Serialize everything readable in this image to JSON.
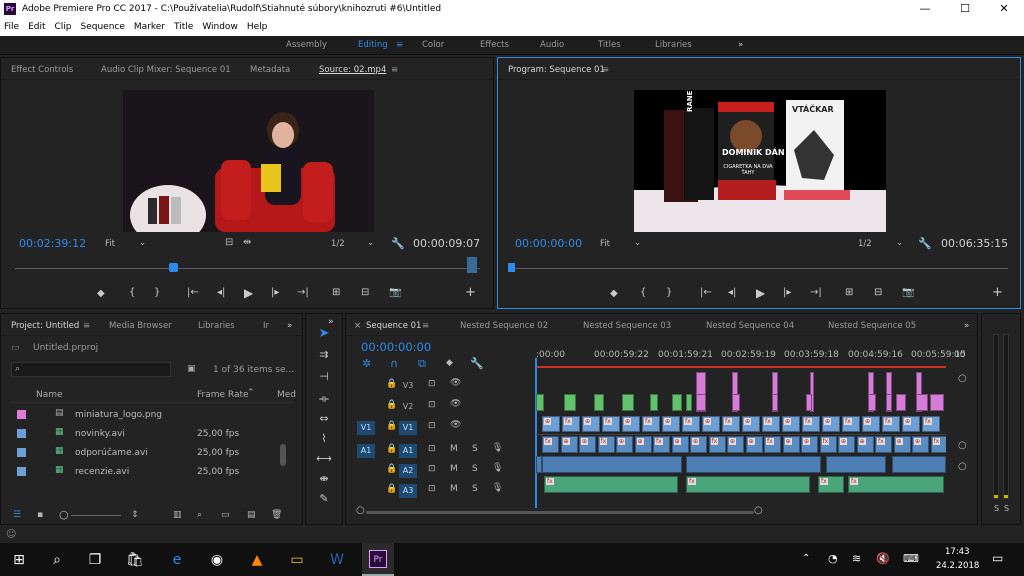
{
  "titlebar": {
    "title": "Adobe Premiere Pro CC 2017 - C:\\Používatelia\\Rudolf\\Stiahnuté súbory\\knihozruti #6\\Untitled",
    "logo": "Pr",
    "min": "—",
    "max": "☐",
    "close": "✕"
  },
  "menu": [
    "File",
    "Edit",
    "Clip",
    "Sequence",
    "Marker",
    "Title",
    "Window",
    "Help"
  ],
  "workspaces": [
    "Assembly",
    "Editing",
    "Color",
    "Effects",
    "Audio",
    "Titles",
    "Libraries"
  ],
  "ws_more": "»",
  "source": {
    "tabs": [
      "Effect Controls",
      "Audio Clip Mixer: Sequence 01",
      "Metadata",
      "Source: 02.mp4"
    ],
    "timecode": "00:02:39:12",
    "fit": "Fit",
    "res": "1/2",
    "duration": "00:00:09:07"
  },
  "program": {
    "tab": "Program: Sequence 01",
    "timecode": "00:00:00:00",
    "fit": "Fit",
    "res": "1/2",
    "duration": "00:06:35:15"
  },
  "project": {
    "tabs": [
      "Project: Untitled",
      "Media Browser",
      "Libraries",
      "Ir"
    ],
    "file": "Untitled.prproj",
    "count": "1 of 36 items se...",
    "col_name": "Name",
    "col_fps": "Frame Rate",
    "col_more": "Med",
    "items": [
      {
        "name": "miniatura_logo.png",
        "fps": "",
        "color": "#e07ad8"
      },
      {
        "name": "novinky.avi",
        "fps": "25,00 fps",
        "color": "#6a9fd8"
      },
      {
        "name": "odporúčame.avi",
        "fps": "25,00 fps",
        "color": "#6a9fd8"
      },
      {
        "name": "recenzie.avi",
        "fps": "25,00 fps",
        "color": "#6a9fd8"
      }
    ]
  },
  "timeline": {
    "tabs": [
      "Sequence 01",
      "Nested Sequence 02",
      "Nested Sequence 03",
      "Nested Sequence 04",
      "Nested Sequence 05"
    ],
    "timecode": "00:00:00:00",
    "ruler": [
      ":00:00",
      "00:00:59:22",
      "00:01:59:21",
      "00:02:59:19",
      "00:03:59:18",
      "00:04:59:16",
      "00:05:59:15",
      "00"
    ],
    "video_tracks": [
      "V3",
      "V2",
      "V1"
    ],
    "audio_tracks": [
      "A1",
      "A2",
      "A3"
    ],
    "src_v": "V1",
    "src_a": "A1",
    "mute": "M",
    "solo": "S"
  },
  "meter": {
    "labels": [
      "S",
      "S"
    ]
  },
  "taskbar": {
    "time": "17:43",
    "date": "24.2.2018"
  },
  "covers": {
    "left": "RANE",
    "mid_title": "DOMINIK DÁN",
    "mid_sub": "CIGARETKA NA DVA ŤAHY",
    "right": "VTÁČKAR"
  }
}
